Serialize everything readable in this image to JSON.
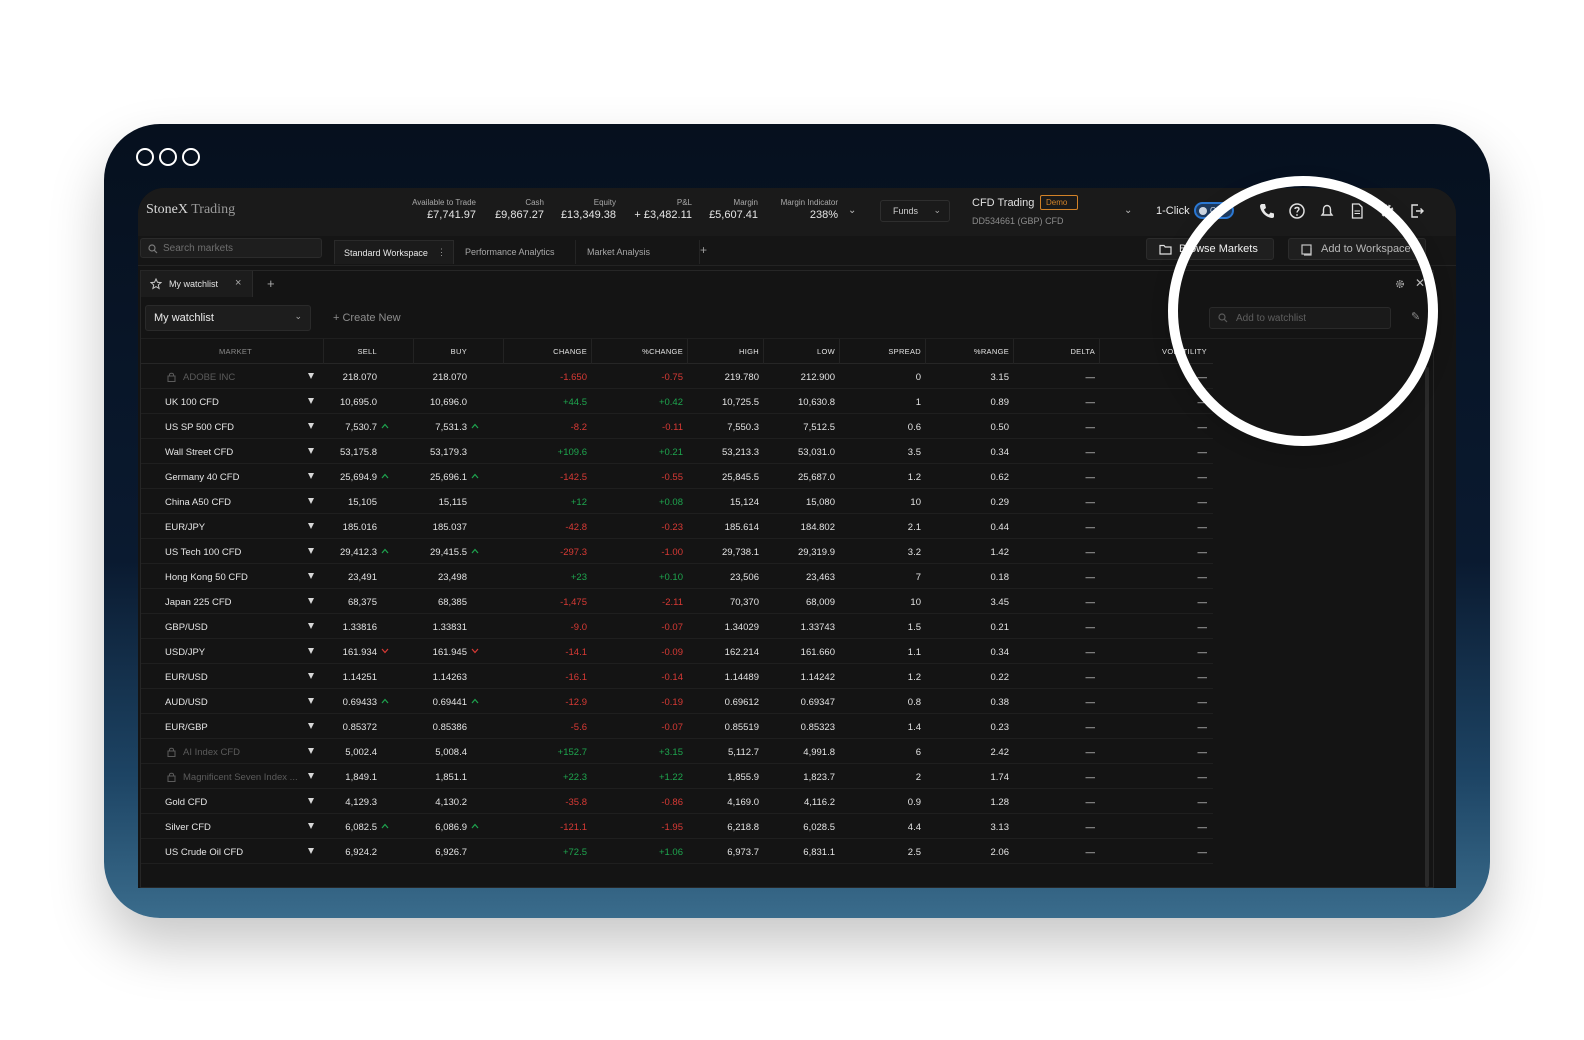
{
  "window": {
    "controls": [
      "circle",
      "circle",
      "circle"
    ]
  },
  "header": {
    "brand": "StoneX",
    "brand_suffix": "Trading",
    "account_summary": [
      {
        "label": "Available to Trade",
        "value": "£7,741.97"
      },
      {
        "label": "Cash",
        "value": "£9,867.27"
      },
      {
        "label": "Equity",
        "value": "£13,349.38"
      },
      {
        "label": "P&L",
        "value": "+ £3,482.11"
      },
      {
        "label": "Margin",
        "value": "£5,607.41"
      },
      {
        "label": "Margin Indicator",
        "value": "238%"
      }
    ],
    "funds_label": "Funds",
    "account_type": "CFD Trading",
    "account_badge": "Demo",
    "account_id": "DD534661 (GBP)",
    "account_id_suffix": "CFD",
    "one_click_label": "1-Click",
    "one_click_state": "Off",
    "icons": [
      "phone-icon",
      "help-icon",
      "bell-icon",
      "document-icon",
      "gear-icon",
      "logout-icon"
    ]
  },
  "workspace": {
    "search_placeholder": "Search markets",
    "tabs": [
      {
        "label": "Standard Workspace",
        "active": true
      },
      {
        "label": "Performance Analytics",
        "active": false
      },
      {
        "label": "Market Analysis",
        "active": false
      }
    ],
    "add_tab": "+",
    "browse_markets": "Browse Markets",
    "add_to_workspace": "Add to Workspace"
  },
  "panel": {
    "tab_label": "My watchlist",
    "tab_close": "×",
    "add": "+",
    "selected_watchlist": "My watchlist",
    "create_new": "+ Create New",
    "add_placeholder": "Add to watchlist"
  },
  "table": {
    "columns": [
      "MARKET",
      "SELL",
      "BUY",
      "CHANGE",
      "%CHANGE",
      "HIGH",
      "LOW",
      "SPREAD",
      "%RANGE",
      "DELTA",
      "VOLATILITY"
    ],
    "rows": [
      {
        "market": "ADOBE INC",
        "locked": true,
        "sell": "218.070",
        "buy": "218.070",
        "dir": "",
        "change": "-1.650",
        "pct": "-0.75",
        "high": "219.780",
        "low": "212.900",
        "spread": "0",
        "range": "3.15",
        "delta": "—",
        "vol": "—"
      },
      {
        "market": "UK 100 CFD",
        "locked": false,
        "sell": "10,695.0",
        "buy": "10,696.0",
        "dir": "",
        "change": "+44.5",
        "pct": "+0.42",
        "high": "10,725.5",
        "low": "10,630.8",
        "spread": "1",
        "range": "0.89",
        "delta": "—",
        "vol": "—"
      },
      {
        "market": "US SP 500 CFD",
        "locked": false,
        "sell": "7,530.7",
        "buy": "7,531.3",
        "dir": "up",
        "change": "-8.2",
        "pct": "-0.11",
        "high": "7,550.3",
        "low": "7,512.5",
        "spread": "0.6",
        "range": "0.50",
        "delta": "—",
        "vol": "—"
      },
      {
        "market": "Wall Street CFD",
        "locked": false,
        "sell": "53,175.8",
        "buy": "53,179.3",
        "dir": "",
        "change": "+109.6",
        "pct": "+0.21",
        "high": "53,213.3",
        "low": "53,031.0",
        "spread": "3.5",
        "range": "0.34",
        "delta": "—",
        "vol": "—"
      },
      {
        "market": "Germany 40 CFD",
        "locked": false,
        "sell": "25,694.9",
        "buy": "25,696.1",
        "dir": "up",
        "change": "-142.5",
        "pct": "-0.55",
        "high": "25,845.5",
        "low": "25,687.0",
        "spread": "1.2",
        "range": "0.62",
        "delta": "—",
        "vol": "—"
      },
      {
        "market": "China A50 CFD",
        "locked": false,
        "sell": "15,105",
        "buy": "15,115",
        "dir": "",
        "change": "+12",
        "pct": "+0.08",
        "high": "15,124",
        "low": "15,080",
        "spread": "10",
        "range": "0.29",
        "delta": "—",
        "vol": "—"
      },
      {
        "market": "EUR/JPY",
        "locked": false,
        "sell": "185.016",
        "buy": "185.037",
        "dir": "",
        "change": "-42.8",
        "pct": "-0.23",
        "high": "185.614",
        "low": "184.802",
        "spread": "2.1",
        "range": "0.44",
        "delta": "—",
        "vol": "—"
      },
      {
        "market": "US Tech 100 CFD",
        "locked": false,
        "sell": "29,412.3",
        "buy": "29,415.5",
        "dir": "up",
        "change": "-297.3",
        "pct": "-1.00",
        "high": "29,738.1",
        "low": "29,319.9",
        "spread": "3.2",
        "range": "1.42",
        "delta": "—",
        "vol": "—"
      },
      {
        "market": "Hong Kong 50 CFD",
        "locked": false,
        "sell": "23,491",
        "buy": "23,498",
        "dir": "",
        "change": "+23",
        "pct": "+0.10",
        "high": "23,506",
        "low": "23,463",
        "spread": "7",
        "range": "0.18",
        "delta": "—",
        "vol": "—"
      },
      {
        "market": "Japan 225 CFD",
        "locked": false,
        "sell": "68,375",
        "buy": "68,385",
        "dir": "",
        "change": "-1,475",
        "pct": "-2.11",
        "high": "70,370",
        "low": "68,009",
        "spread": "10",
        "range": "3.45",
        "delta": "—",
        "vol": "—"
      },
      {
        "market": "GBP/USD",
        "locked": false,
        "sell": "1.33816",
        "buy": "1.33831",
        "dir": "",
        "change": "-9.0",
        "pct": "-0.07",
        "high": "1.34029",
        "low": "1.33743",
        "spread": "1.5",
        "range": "0.21",
        "delta": "—",
        "vol": "—"
      },
      {
        "market": "USD/JPY",
        "locked": false,
        "sell": "161.934",
        "buy": "161.945",
        "dir": "down",
        "change": "-14.1",
        "pct": "-0.09",
        "high": "162.214",
        "low": "161.660",
        "spread": "1.1",
        "range": "0.34",
        "delta": "—",
        "vol": "—"
      },
      {
        "market": "EUR/USD",
        "locked": false,
        "sell": "1.14251",
        "buy": "1.14263",
        "dir": "",
        "change": "-16.1",
        "pct": "-0.14",
        "high": "1.14489",
        "low": "1.14242",
        "spread": "1.2",
        "range": "0.22",
        "delta": "—",
        "vol": "—"
      },
      {
        "market": "AUD/USD",
        "locked": false,
        "sell": "0.69433",
        "buy": "0.69441",
        "dir": "up",
        "change": "-12.9",
        "pct": "-0.19",
        "high": "0.69612",
        "low": "0.69347",
        "spread": "0.8",
        "range": "0.38",
        "delta": "—",
        "vol": "—"
      },
      {
        "market": "EUR/GBP",
        "locked": false,
        "sell": "0.85372",
        "buy": "0.85386",
        "dir": "",
        "change": "-5.6",
        "pct": "-0.07",
        "high": "0.85519",
        "low": "0.85323",
        "spread": "1.4",
        "range": "0.23",
        "delta": "—",
        "vol": "—"
      },
      {
        "market": "AI Index CFD",
        "locked": true,
        "sell": "5,002.4",
        "buy": "5,008.4",
        "dir": "",
        "change": "+152.7",
        "pct": "+3.15",
        "high": "5,112.7",
        "low": "4,991.8",
        "spread": "6",
        "range": "2.42",
        "delta": "—",
        "vol": "—"
      },
      {
        "market": "Magnificent Seven Index ...",
        "locked": true,
        "sell": "1,849.1",
        "buy": "1,851.1",
        "dir": "",
        "change": "+22.3",
        "pct": "+1.22",
        "high": "1,855.9",
        "low": "1,823.7",
        "spread": "2",
        "range": "1.74",
        "delta": "—",
        "vol": "—"
      },
      {
        "market": "Gold CFD",
        "locked": false,
        "sell": "4,129.3",
        "buy": "4,130.2",
        "dir": "",
        "change": "-35.8",
        "pct": "-0.86",
        "high": "4,169.0",
        "low": "4,116.2",
        "spread": "0.9",
        "range": "1.28",
        "delta": "—",
        "vol": "—"
      },
      {
        "market": "Silver CFD",
        "locked": false,
        "sell": "6,082.5",
        "buy": "6,086.9",
        "dir": "up",
        "change": "-121.1",
        "pct": "-1.95",
        "high": "6,218.8",
        "low": "6,028.5",
        "spread": "4.4",
        "range": "3.13",
        "delta": "—",
        "vol": "—"
      },
      {
        "market": "US Crude Oil CFD",
        "locked": false,
        "sell": "6,924.2",
        "buy": "6,926.7",
        "dir": "",
        "change": "+72.5",
        "pct": "+1.06",
        "high": "6,973.7",
        "low": "6,831.1",
        "spread": "2.5",
        "range": "2.06",
        "delta": "—",
        "vol": "—"
      }
    ]
  },
  "colors": {
    "up": "#1ea54e",
    "down": "#d83a35",
    "accent": "#2b78d3",
    "demo": "#d28228"
  }
}
